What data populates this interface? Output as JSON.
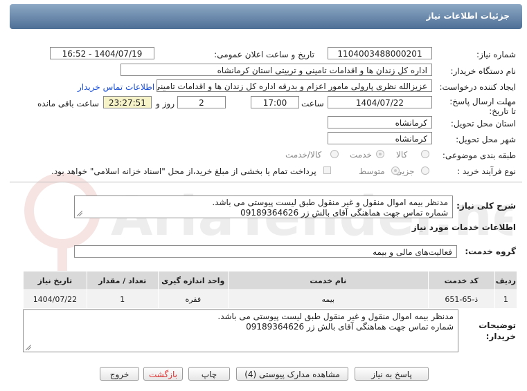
{
  "header": {
    "title": "جزئیات اطلاعات نیاز"
  },
  "fields": {
    "need_number_label": "شماره نیاز:",
    "need_number": "1104003488000201",
    "announce_label": "تاریخ و ساعت اعلان عمومی:",
    "announce_value": "1404/07/19 - 16:52",
    "buyer_label": "نام دستگاه خریدار:",
    "buyer_value": "اداره کل زندان ها و اقدامات تامینی و تربیتی استان کرمانشاه",
    "creator_label": "ایجاد کننده درخواست:",
    "creator_value": "عزیزالله نظری پارولی مامور اعزام و بدرقه اداره کل زندان ها و اقدامات تامینی و تر",
    "contact_link": "اطلاعات تماس خریدار",
    "deadline_label": "مهلت ارسال پاسخ: تا تاریخ:",
    "deadline_date": "1404/07/22",
    "time_label": "ساعت",
    "deadline_time": "17:00",
    "days_value": "2",
    "days_label": "روز و",
    "remaining_time": "23:27:51",
    "remaining_label": "ساعت باقی مانده",
    "province_label": "استان محل تحویل:",
    "province_value": "کرمانشاه",
    "city_label": "شهر محل تحویل:",
    "city_value": "کرمانشاه",
    "category_label": "طبقه بندی موضوعی:",
    "category_options": [
      "کالا",
      "خدمت",
      "کالا/خدمت"
    ],
    "process_label": "نوع فرآیند خرید :",
    "process_options": [
      "جزیی",
      "متوسط"
    ],
    "payment_note": "پرداخت تمام یا بخشی از مبلغ خرید،از محل \"اسناد خزانه اسلامی\" خواهد بود."
  },
  "summary": {
    "label": "شرح کلی نیاز:",
    "line1": "مدنظر بیمه اموال منقول و غیر منقول طبق لیست پیوستی می باشد.",
    "line2": "شماره تماس جهت هماهنگی آقای بالش زر 09189364626"
  },
  "services": {
    "section_title": "اطلاعات خدمات مورد نیاز",
    "group_label": "گروه خدمت:",
    "group_value": "فعالیت‌های مالی و بیمه",
    "columns": [
      "ردیف",
      "کد خدمت",
      "نام خدمت",
      "واحد اندازه گیری",
      "تعداد / مقدار",
      "تاریخ نیاز"
    ],
    "rows": [
      [
        "1",
        "ذ-65-651",
        "بیمه",
        "فقره",
        "1",
        "1404/07/22"
      ]
    ]
  },
  "buyer_notes": {
    "label": "توضیحات خریدار:",
    "line1": "مدنظر بیمه اموال منقول و غیر منقول طبق لیست پیوستی می باشد.",
    "line2": "شماره تماس جهت هماهنگی آقای بالش زر 09189364626"
  },
  "buttons": {
    "reply": "پاسخ به نیاز",
    "documents": "مشاهده مدارک پیوستی (4)",
    "print": "چاپ",
    "back": "بازگشت",
    "exit": "خروج"
  },
  "watermark": {
    "text": "AriaTender.net"
  },
  "colors": {
    "header": "#5a7aa0",
    "link": "#1a4fd8",
    "highlight": "#f7f3c8",
    "red": "#d33333"
  }
}
